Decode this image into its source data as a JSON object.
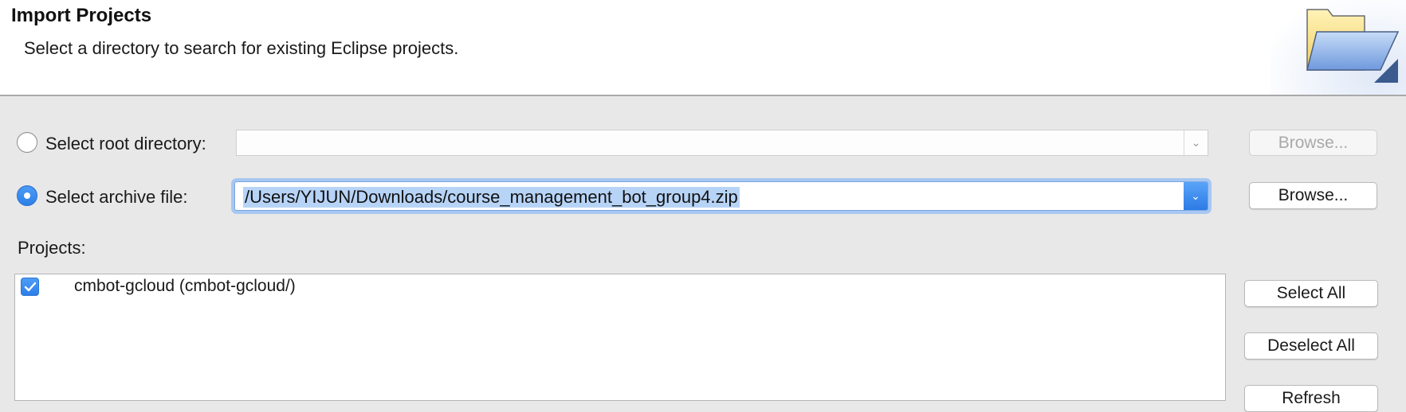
{
  "header": {
    "title": "Import Projects",
    "description": "Select a directory to search for existing Eclipse projects.",
    "banner_icon": "folder-open-icon"
  },
  "root_directory": {
    "label": "Select root directory:",
    "selected": false,
    "value": "",
    "browse_label": "Browse...",
    "enabled": false
  },
  "archive_file": {
    "label": "Select archive file:",
    "selected": true,
    "value": "/Users/YIJUN/Downloads/course_management_bot_group4.zip",
    "browse_label": "Browse...",
    "enabled": true
  },
  "projects": {
    "label": "Projects:",
    "items": [
      {
        "label": "cmbot-gcloud (cmbot-gcloud/)",
        "checked": true
      }
    ]
  },
  "actions": {
    "select_all": "Select All",
    "deselect_all": "Deselect All",
    "refresh": "Refresh"
  },
  "colors": {
    "accent": "#2d7fe8",
    "selection_highlight": "#b7d4f7"
  }
}
